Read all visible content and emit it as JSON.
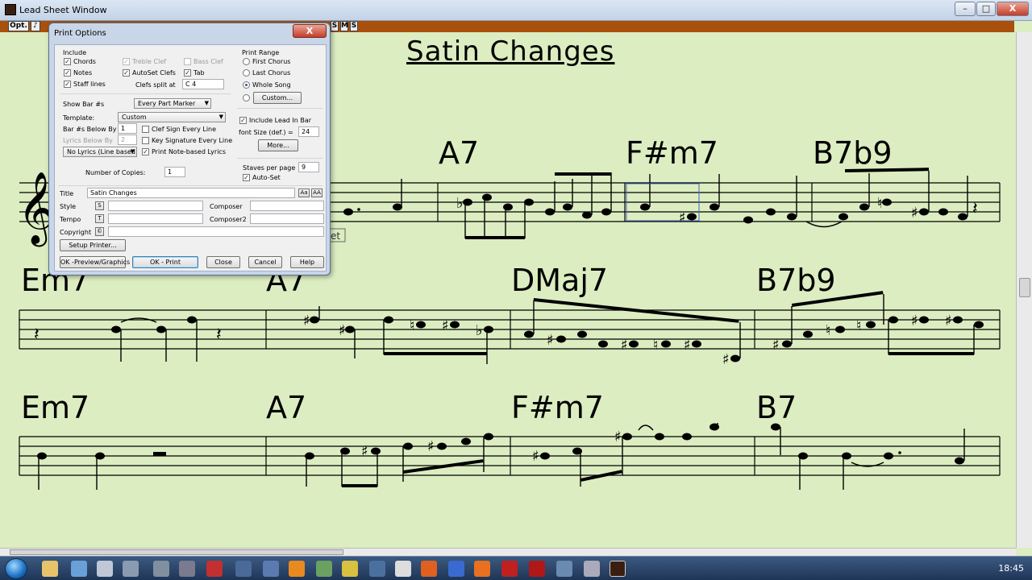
{
  "window": {
    "title": "Lead Sheet Window",
    "controls": {
      "minimize": "–",
      "maximize": "□",
      "close": "X"
    }
  },
  "toolbar": {
    "opt_label": "Opt.",
    "note_icon": "♪",
    "small_buttons": [
      "S",
      "M",
      "S"
    ]
  },
  "sheet": {
    "song_title": "Satin Changes",
    "rows": [
      {
        "chords": [
          {
            "name": "A7"
          },
          {
            "name": "F#m7"
          },
          {
            "name": "B7b9"
          }
        ]
      },
      {
        "chords": [
          {
            "name": "Em7"
          },
          {
            "name": "A7"
          },
          {
            "name": "DMaj7"
          },
          {
            "name": "B7b9"
          }
        ]
      },
      {
        "chords": [
          {
            "name": "Em7"
          },
          {
            "name": "A7"
          },
          {
            "name": "F#m7"
          },
          {
            "name": "B7"
          }
        ]
      }
    ],
    "partial_text": "et",
    "colors": {
      "background": "#dcedc1",
      "toolbar": "#a8500c"
    }
  },
  "dialog": {
    "title": "Print Options",
    "close_label": "X",
    "include": {
      "heading": "Include",
      "chords": {
        "label": "Chords",
        "checked": true
      },
      "notes": {
        "label": "Notes",
        "checked": true
      },
      "staff_lines": {
        "label": "Staff lines",
        "checked": true
      },
      "treble_clef": {
        "label": "Treble Clef",
        "checked": true
      },
      "autoset_clefs": {
        "label": "AutoSet Clefs",
        "checked": true
      },
      "bass_clef": {
        "label": "Bass Clef",
        "checked": false
      },
      "tab": {
        "label": "Tab",
        "checked": true
      },
      "clefs_split_label": "Clefs split at",
      "clefs_split_value": "C 4"
    },
    "show_bar": {
      "label": "Show Bar #s",
      "value": "Every Part Marker"
    },
    "template": {
      "label": "Template:",
      "value": "Custom"
    },
    "bar_below": {
      "label": "Bar #s Below By",
      "value": "1"
    },
    "lyrics_below": {
      "label": "Lyrics Below By",
      "value": "2"
    },
    "lyrics_select": "No Lyrics (Line based)",
    "clef_sign_every_line": {
      "label": "Clef Sign Every Line",
      "checked": false
    },
    "key_sig_every_line": {
      "label": "Key Signature Every Line",
      "checked": false
    },
    "print_note_lyrics": {
      "label": "Print Note-based Lyrics",
      "checked": true
    },
    "print_range": {
      "heading": "Print Range",
      "options": [
        "First Chorus",
        "Last Chorus",
        "Whole Song"
      ],
      "selected": "Whole Song",
      "custom_button": "Custom..."
    },
    "include_lead_in": {
      "label": "Include Lead In Bar",
      "checked": true
    },
    "font_size": {
      "label": "font Size (def.) =",
      "value": "24"
    },
    "more_button": "More...",
    "staves_per_page": {
      "label": "Staves per page",
      "value": "9"
    },
    "auto_set": {
      "label": "Auto-Set",
      "checked": true
    },
    "copies": {
      "label": "Number of Copies:",
      "value": "1"
    },
    "title_field": {
      "label": "Title",
      "value": "Satin Changes"
    },
    "style_field": {
      "label": "Style",
      "button": "S",
      "value": ""
    },
    "tempo_field": {
      "label": "Tempo",
      "button": "T",
      "value": ""
    },
    "copyright_field": {
      "label": "Copyright",
      "button": "©",
      "value": ""
    },
    "composer_field": {
      "label": "Composer",
      "value": ""
    },
    "composer2_field": {
      "label": "Composer2",
      "value": ""
    },
    "font_buttons": [
      "Aa",
      "AA"
    ],
    "setup_printer": "Setup Printer...",
    "bottom_buttons": {
      "preview": "OK -Preview/Graphics",
      "ok_print": "OK - Print",
      "close": "Close",
      "cancel": "Cancel",
      "help": "Help"
    }
  },
  "taskbar": {
    "clock": "18:45"
  }
}
